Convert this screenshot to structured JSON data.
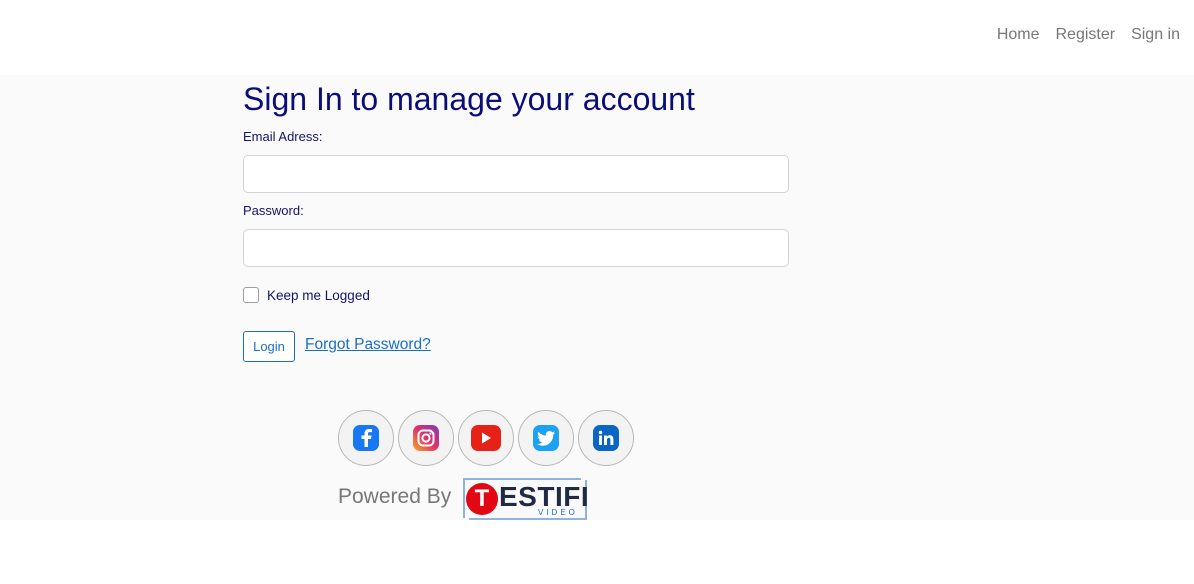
{
  "nav": {
    "home": "Home",
    "register": "Register",
    "signin": "Sign in"
  },
  "form": {
    "title": "Sign In to manage your account",
    "email_label": "Email Adress:",
    "email_value": "",
    "password_label": "Password:",
    "password_value": "",
    "keep_label": "Keep me Logged",
    "keep_checked": false,
    "login_label": "Login",
    "forgot_label": "Forgot Password?"
  },
  "social": [
    {
      "name": "facebook",
      "icon": "facebook-icon",
      "color": "#1877f2"
    },
    {
      "name": "instagram",
      "icon": "instagram-icon",
      "color": "#c13584"
    },
    {
      "name": "youtube",
      "icon": "youtube-icon",
      "color": "#e62117"
    },
    {
      "name": "twitter",
      "icon": "twitter-icon",
      "color": "#1da1f2"
    },
    {
      "name": "linkedin",
      "icon": "linkedin-icon",
      "color": "#0a66c2"
    }
  ],
  "footer": {
    "powered_by": "Powered By",
    "logo_text": "ESTIFI",
    "logo_initial": "T",
    "logo_sub": "VIDEO"
  },
  "colors": {
    "title": "#0d0d7a",
    "link": "#1a6fc4",
    "nav": "#777777",
    "logo_red": "#e30613"
  }
}
